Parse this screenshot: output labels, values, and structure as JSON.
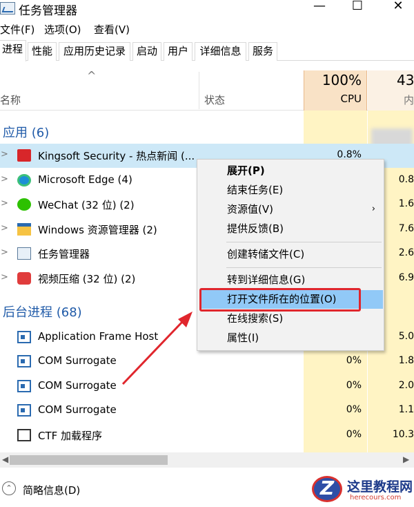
{
  "window": {
    "title": "任务管理器",
    "minimize": "—",
    "maximize": "☐",
    "close": "✕"
  },
  "menu": [
    "文件(F)",
    "选项(O)",
    "查看(V)"
  ],
  "tabs": [
    "进程",
    "性能",
    "应用历史记录",
    "启动",
    "用户",
    "详细信息",
    "服务"
  ],
  "columns": {
    "sort_arrow": "^",
    "name": "名称",
    "status": "状态",
    "cpu_percent": "100%",
    "cpu_label": "CPU",
    "mem_percent": "43",
    "mem_label": "内"
  },
  "groups": {
    "apps": "应用 (6)",
    "background": "后台进程 (68)"
  },
  "apps": [
    {
      "name": "Kingsoft Security - 热点新闻 (...",
      "cpu": "0.8%",
      "mem": "",
      "icon": "kingsoft-icon"
    },
    {
      "name": "Microsoft Edge (4)",
      "cpu": "",
      "mem": "0.8",
      "icon": "edge-icon"
    },
    {
      "name": "WeChat (32 位) (2)",
      "cpu": "",
      "mem": "1.6",
      "icon": "wechat-icon"
    },
    {
      "name": "Windows 资源管理器 (2)",
      "cpu": "",
      "mem": "7.6",
      "icon": "explorer-icon"
    },
    {
      "name": "任务管理器",
      "cpu": "",
      "mem": "2.6",
      "icon": "taskmgr-icon"
    },
    {
      "name": "视频压缩 (32 位) (2)",
      "cpu": "",
      "mem": "6.9",
      "icon": "video-icon"
    }
  ],
  "background": [
    {
      "name": "Application Frame Host",
      "cpu": "",
      "mem": "5.0"
    },
    {
      "name": "COM Surrogate",
      "cpu": "0%",
      "mem": "1.8"
    },
    {
      "name": "COM Surrogate",
      "cpu": "0%",
      "mem": "2.0"
    },
    {
      "name": "COM Surrogate",
      "cpu": "0%",
      "mem": "1.1"
    },
    {
      "name": "CTF 加载程序",
      "cpu": "0%",
      "mem": "10.3"
    }
  ],
  "context_menu": {
    "expand": "展开(P)",
    "end_task": "结束任务(E)",
    "resource_values": "资源值(V)",
    "feedback": "提供反馈(B)",
    "dump": "创建转储文件(C)",
    "goto_details": "转到详细信息(G)",
    "open_location": "打开文件所在的位置(O)",
    "search_online": "在线搜索(S)",
    "properties": "属性(I)",
    "submenu_arrow": "›"
  },
  "footer": {
    "less_details": "简略信息(D)"
  },
  "watermark": {
    "title": "这里教程网",
    "url": "herecours.com",
    "logo_letter": "Z"
  },
  "colors": {
    "group_title": "#1f5aa8",
    "cpu_header": "#f9e2c6",
    "data_band": "#fff4c4",
    "row_selected": "#cde8f7",
    "menu_hover": "#91c9f7",
    "highlight": "#e0262d",
    "arrow": "#e0262d"
  }
}
